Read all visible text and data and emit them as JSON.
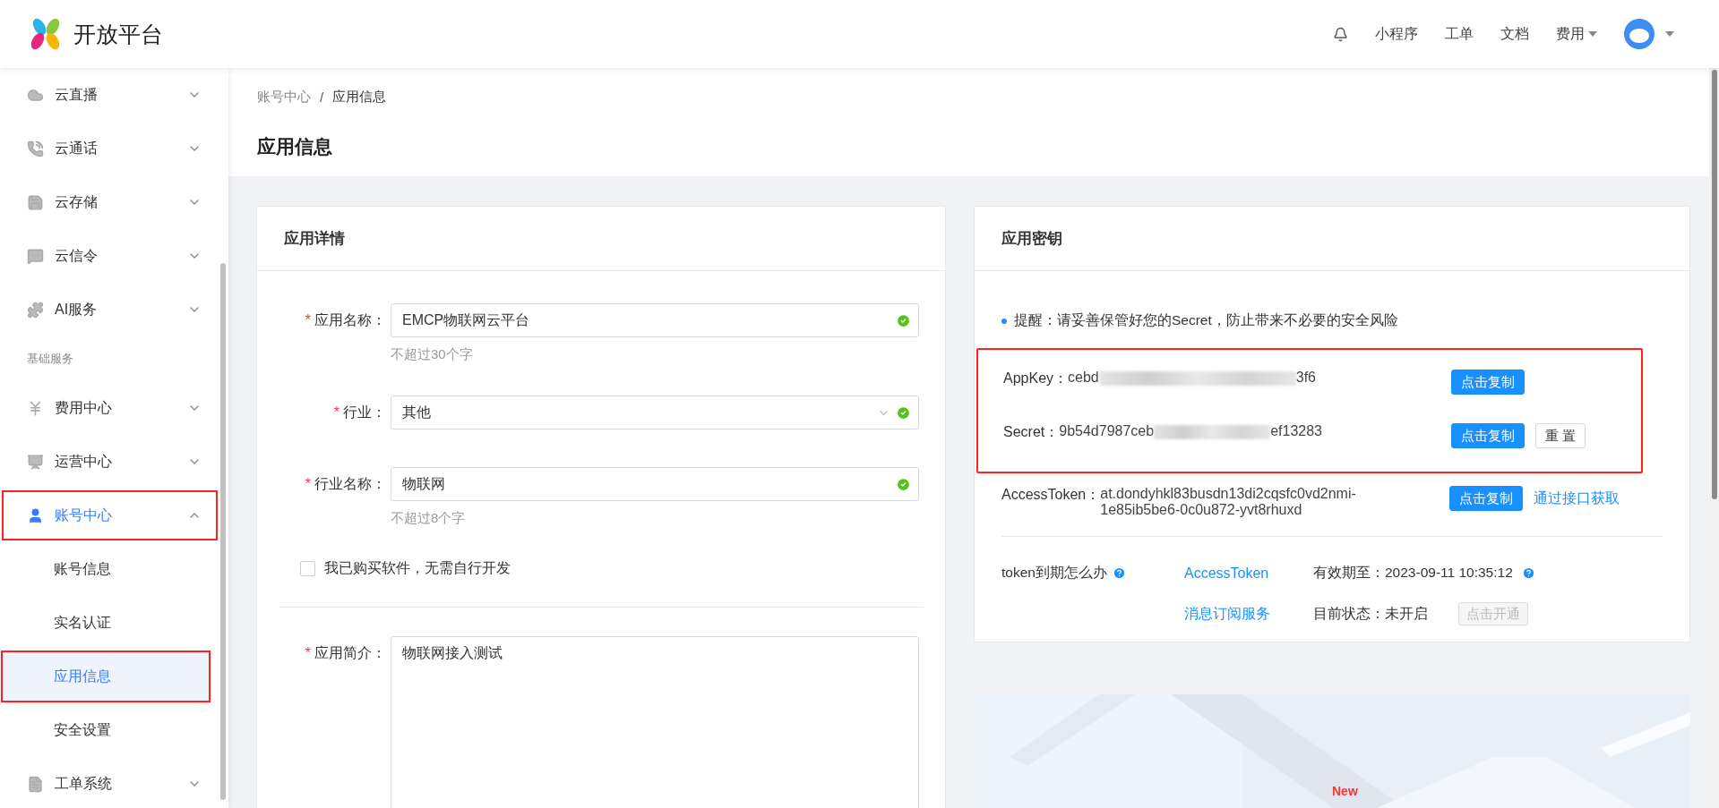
{
  "header": {
    "brand": "开放平台",
    "nav": [
      {
        "label": "小程序",
        "dropdown": false
      },
      {
        "label": "工单",
        "dropdown": false
      },
      {
        "label": "文档",
        "dropdown": false
      },
      {
        "label": "费用",
        "dropdown": true
      }
    ]
  },
  "sidebar": {
    "items": [
      {
        "kind": "item",
        "label": "云直播",
        "expanded": false,
        "outlined": false
      },
      {
        "kind": "item",
        "label": "云通话",
        "expanded": false,
        "outlined": false
      },
      {
        "kind": "item",
        "label": "云存储",
        "expanded": false,
        "outlined": false
      },
      {
        "kind": "item",
        "label": "云信令",
        "expanded": false,
        "outlined": false
      },
      {
        "kind": "item",
        "label": "AI服务",
        "expanded": false,
        "outlined": false
      },
      {
        "kind": "section",
        "label": "基础服务"
      },
      {
        "kind": "item",
        "label": "费用中心",
        "expanded": false,
        "outlined": false
      },
      {
        "kind": "item",
        "label": "运营中心",
        "expanded": false,
        "outlined": false
      },
      {
        "kind": "item",
        "label": "账号中心",
        "expanded": true,
        "outlined": true,
        "children": [
          {
            "label": "账号信息",
            "selected": false,
            "outlined": false
          },
          {
            "label": "实名认证",
            "selected": false,
            "outlined": false
          },
          {
            "label": "应用信息",
            "selected": true,
            "outlined": true
          },
          {
            "label": "安全设置",
            "selected": false,
            "outlined": false
          }
        ]
      },
      {
        "kind": "item",
        "label": "工单系统",
        "expanded": false,
        "outlined": false
      }
    ]
  },
  "breadcrumb": {
    "items": [
      "账号中心",
      "应用信息"
    ],
    "separator": "/"
  },
  "page_title": "应用信息",
  "details": {
    "title": "应用详情",
    "required_mark": "*",
    "fields": [
      {
        "kind": "input",
        "label": "应用名称：",
        "required": true,
        "value": "EMCP物联网云平台",
        "valid": true,
        "hint": "不超过30个字"
      },
      {
        "kind": "select",
        "label": "行业：",
        "required": true,
        "value": "其他",
        "valid": true
      },
      {
        "kind": "input",
        "label": "行业名称：",
        "required": true,
        "value": "物联网",
        "valid": true,
        "hint": "不超过8个字"
      },
      {
        "kind": "checkbox",
        "label": "我已购买软件，无需自行开发",
        "checked": false
      },
      {
        "kind": "divider"
      },
      {
        "kind": "textarea",
        "label": "应用简介：",
        "required": true,
        "value": "物联网接入测试"
      }
    ]
  },
  "keys": {
    "title": "应用密钥",
    "notice": "提醒：请妥善保管好您的Secret，防止带来不必要的安全风险",
    "rows": [
      {
        "label": "AppKey：",
        "value_start": "cebd",
        "value_end": "3f6",
        "masked": true,
        "outlined": true,
        "actions": [
          {
            "kind": "primary",
            "label": "点击复制"
          }
        ]
      },
      {
        "label": "Secret：",
        "value_start": "9b54d7987ceb",
        "value_end": "ef13283",
        "masked": true,
        "outlined": true,
        "actions": [
          {
            "kind": "primary",
            "label": "点击复制"
          },
          {
            "kind": "default",
            "label": "重 置"
          }
        ]
      },
      {
        "label": "AccessToken：",
        "value_start": "at.dondyhkl83busdn13di2cqsfc0vd2nmi-1e85ib5be6-0c0u872-yvt8rhuxd",
        "masked": false,
        "outlined": false,
        "actions": [
          {
            "kind": "primary",
            "label": "点击复制"
          },
          {
            "kind": "link",
            "label": "通过接口获取"
          }
        ]
      }
    ],
    "token_question": "token到期怎么办",
    "services": [
      {
        "name": "AccessToken",
        "detail": "有效期至：2023-09-11 10:35:12",
        "help": true
      },
      {
        "name": "消息订阅服务",
        "detail": "目前状态：未开启",
        "help": false,
        "action": {
          "label": "点击开通",
          "disabled": true
        }
      }
    ]
  },
  "banner": {
    "kind": "picture",
    "badge": "New"
  }
}
